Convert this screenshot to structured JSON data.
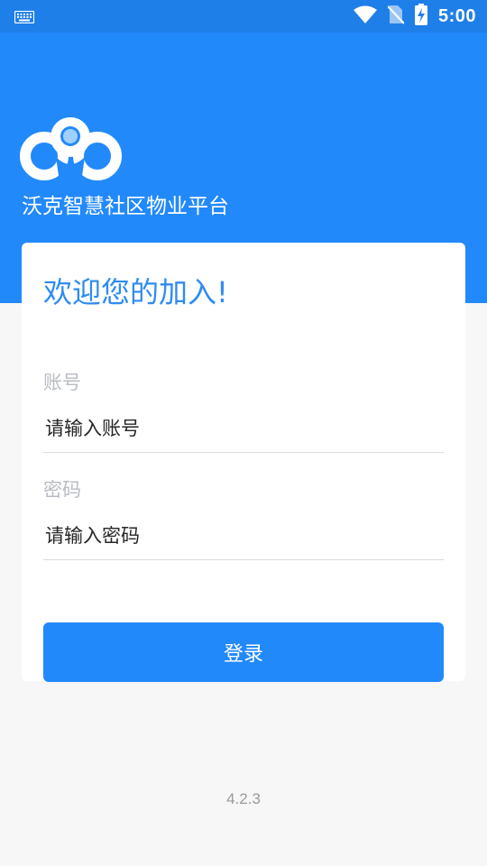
{
  "status_bar": {
    "time": "5:00",
    "left_icon": "keyboard-icon",
    "right_icons": [
      "wifi-icon",
      "no-sim-icon",
      "battery-charging-icon"
    ]
  },
  "header": {
    "logo_icon": "cloud-logo-icon",
    "app_name": "沃克智慧社区物业平台"
  },
  "login_card": {
    "welcome": "欢迎您的加入!",
    "account": {
      "label": "账号",
      "placeholder": "请输入账号"
    },
    "password": {
      "label": "密码",
      "placeholder": "请输入密码"
    },
    "submit_label": "登录"
  },
  "footer": {
    "version": "4.2.3"
  },
  "colors": {
    "primary": "#2289fb",
    "status_bar": "#1f7fe8",
    "welcome_text": "#2e8cf0",
    "background": "#f7f7f7",
    "label_gray": "#b8bcc2"
  }
}
